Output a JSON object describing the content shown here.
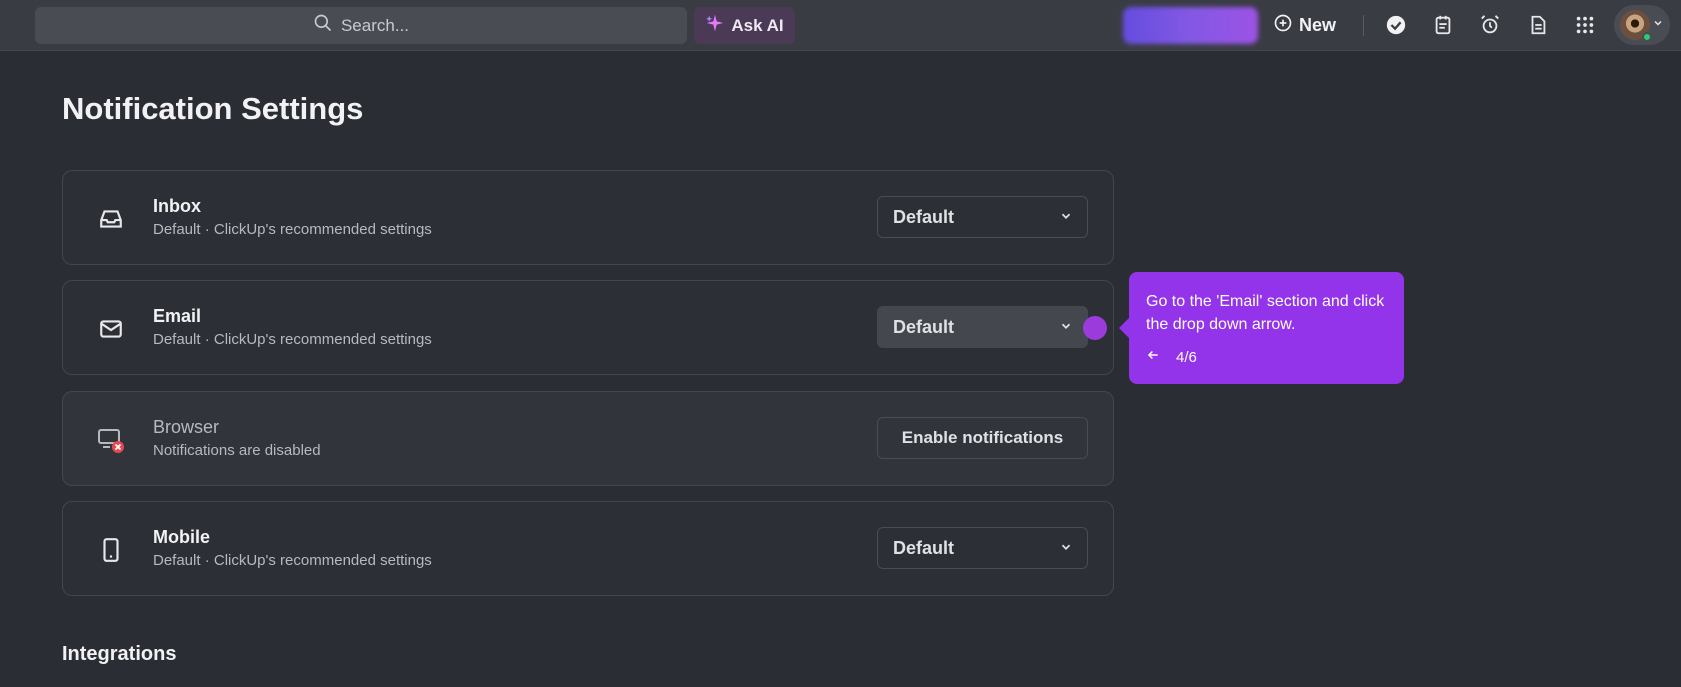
{
  "topbar": {
    "search_placeholder": "Search...",
    "ask_ai_label": "Ask AI",
    "new_label": "New"
  },
  "page": {
    "title": "Notification Settings"
  },
  "channels": [
    {
      "title": "Inbox",
      "subtitle": "Default · ClickUp's recommended settings",
      "select_value": "Default"
    },
    {
      "title": "Email",
      "subtitle": "Default · ClickUp's recommended settings",
      "select_value": "Default"
    },
    {
      "title": "Browser",
      "subtitle": "Notifications are disabled",
      "button_label": "Enable notifications"
    },
    {
      "title": "Mobile",
      "subtitle": "Default · ClickUp's recommended settings",
      "select_value": "Default"
    }
  ],
  "tooltip": {
    "text": "Go to the 'Email' section and click the drop down arrow.",
    "step": "4/6"
  },
  "sections": {
    "integrations_title": "Integrations"
  },
  "colors": {
    "accent": "#9333ea",
    "background": "#2b2d35",
    "topbar": "#3a3c44"
  }
}
